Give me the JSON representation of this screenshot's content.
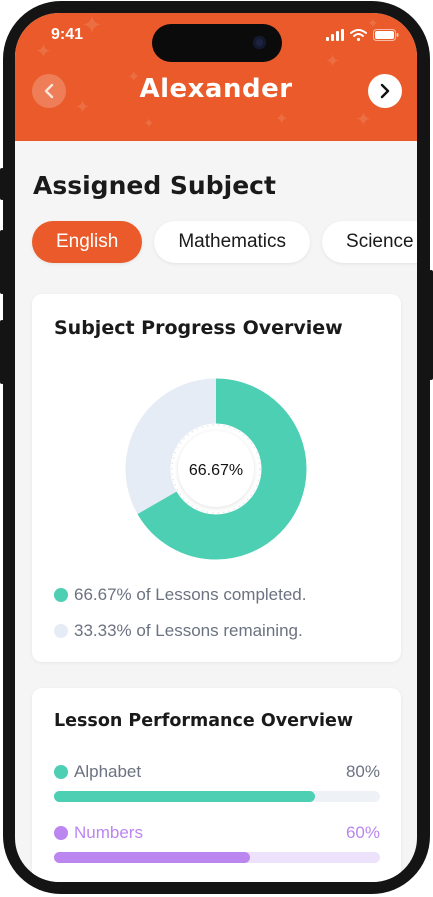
{
  "status_bar": {
    "time": "9:41"
  },
  "header": {
    "title": "Alexander",
    "back_icon": "chevron-left-icon",
    "next_icon": "chevron-right-icon"
  },
  "section": {
    "title": "Assigned Subject"
  },
  "tabs": [
    {
      "label": "English",
      "active": true
    },
    {
      "label": "Mathematics",
      "active": false
    },
    {
      "label": "Science",
      "active": false
    }
  ],
  "progress_card": {
    "title": "Subject Progress Overview",
    "center_label": "66.67%",
    "completed_fraction": 0.6667,
    "legend": [
      {
        "text": "66.67% of Lessons completed.",
        "color": "#4ccfb3"
      },
      {
        "text": "33.33% of Lessons remaining.",
        "color": "#e6ecf5"
      }
    ]
  },
  "performance_card": {
    "title": "Lesson Performance Overview",
    "items": [
      {
        "label": "Alphabet",
        "value_text": "80%",
        "value": 80,
        "color": "#4ccfb3",
        "label_color": "#6b7280",
        "track": "#eef1f6"
      },
      {
        "label": "Numbers",
        "value_text": "60%",
        "value": 60,
        "color": "#bb86f0",
        "label_color": "#bb86f0",
        "track": "#ece2fb"
      }
    ]
  },
  "colors": {
    "accent": "#ea5a2a",
    "teal": "#4ccfb3",
    "purple": "#bb86f0"
  }
}
